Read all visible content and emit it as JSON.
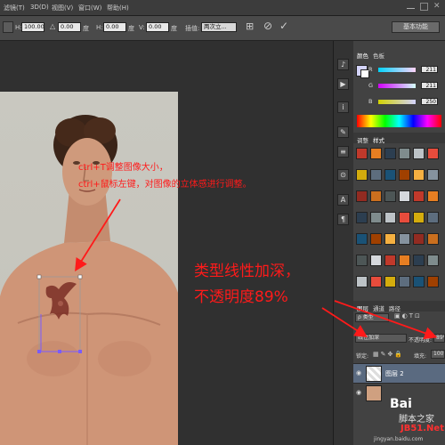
{
  "menu": {
    "items": [
      "滤镜(T)",
      "3D(D)",
      "视图(V)",
      "窗口(W)",
      "帮助(H)"
    ]
  },
  "options": {
    "h_label": "H:",
    "h_percent": "100.00%",
    "angle_value": "0.00",
    "angle_unit": "度",
    "h_skew_label": "H:",
    "h_skew_value": "0.00",
    "h_skew_unit": "度",
    "v_label": "V:",
    "v_value": "0.00",
    "v_unit": "度",
    "interp_label": "插值:",
    "interp_value": "两次立...",
    "workspace": "基本功能"
  },
  "panels": {
    "color_tab": "颜色",
    "swatches_tab": "色板",
    "r_label": "R",
    "g_label": "G",
    "b_label": "B",
    "r_value": "211",
    "g_value": "211",
    "b_value": "250",
    "adjust_tab": "调整",
    "styles_tab": "样式",
    "layers_tab": "图层",
    "channels_tab": "通道",
    "paths_tab": "路径",
    "kind_label": "ρ 类型",
    "blend_mode": "线性加深",
    "opacity_label": "不透明度:",
    "opacity_value": "89%",
    "lock_label": "锁定:",
    "fill_label": "填充:",
    "fill_value": "100%",
    "layer_name": "图层 2"
  },
  "annotations": {
    "instr_line1": "ctrl+T调整图像大小，",
    "instr_line2": "ctrl+鼠标左键，对图像的立体感进行调整。",
    "blend_line1": "类型线性加深，",
    "blend_line2": "不透明度89%"
  },
  "watermark": {
    "brand": "Bai",
    "site_cn": "脚本之家",
    "site_url": "JB51.Net",
    "sub": "jingyan.baidu.com"
  },
  "colors": {
    "annotation_red": "#ff1a1a",
    "panel_bg": "#424242",
    "canvas_bg": "#303030"
  }
}
